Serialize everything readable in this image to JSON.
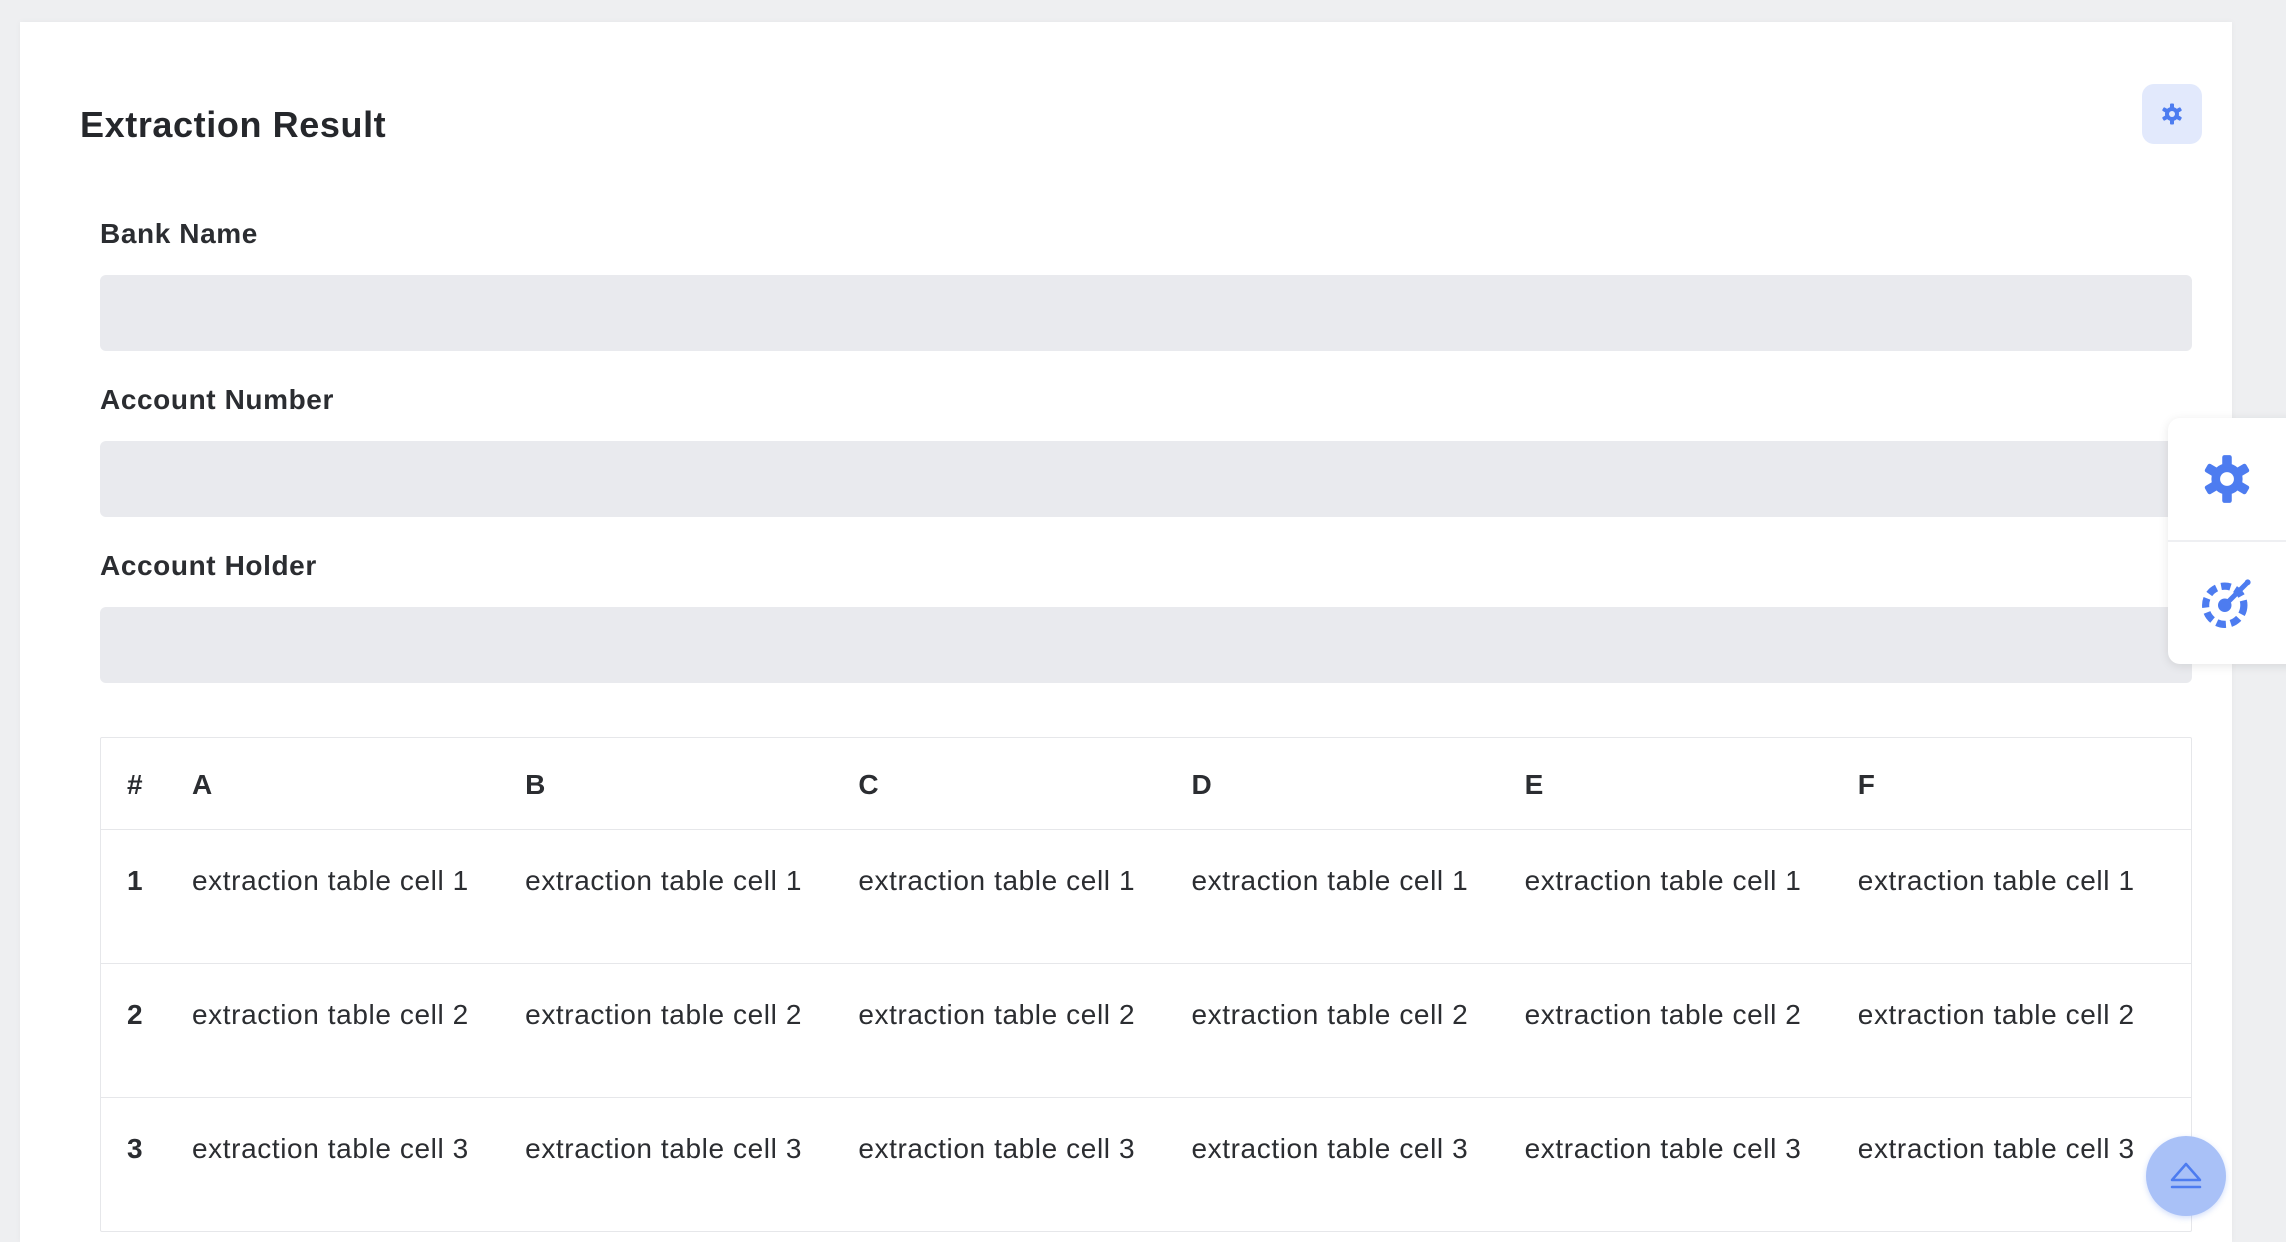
{
  "page": {
    "title": "Extraction Result"
  },
  "fields": [
    {
      "label": "Bank Name",
      "value": "",
      "placeholder": ""
    },
    {
      "label": "Account Number",
      "value": "",
      "placeholder": ""
    },
    {
      "label": "Account Holder",
      "value": "",
      "placeholder": ""
    }
  ],
  "table": {
    "headers": [
      "#",
      "A",
      "B",
      "C",
      "D",
      "E",
      "F"
    ],
    "rows": [
      [
        "1",
        "extraction table cell 1",
        "extraction table cell 1",
        "extraction table cell 1",
        "extraction table cell 1",
        "extraction table cell 1",
        "extraction table cell 1"
      ],
      [
        "2",
        "extraction table cell 2",
        "extraction table cell 2",
        "extraction table cell 2",
        "extraction table cell 2",
        "extraction table cell 2",
        "extraction table cell 2"
      ],
      [
        "3",
        "extraction table cell 3",
        "extraction table cell 3",
        "extraction table cell 3",
        "extraction table cell 3",
        "extraction table cell 3",
        "extraction table cell 3"
      ]
    ]
  },
  "icons": {
    "card_settings": "gear-icon",
    "panel_settings": "gear-icon",
    "panel_theme": "palette-brush-icon",
    "scroll_top": "eject-icon"
  },
  "colors": {
    "accent": "#4d7cf0",
    "accent_light": "#e2e9fc",
    "input_bg": "#e9eaee",
    "scroll_btn_bg": "#a9c1f7"
  }
}
